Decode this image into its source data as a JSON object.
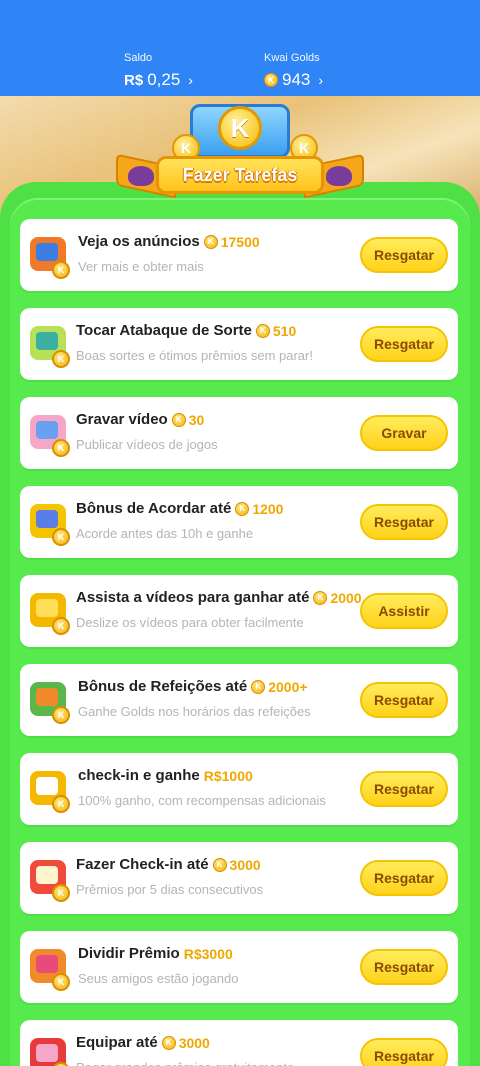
{
  "header": {
    "saldo_label": "Saldo",
    "saldo_currency": "R$",
    "saldo_value": "0,25",
    "golds_label": "Kwai Golds",
    "golds_value": "943",
    "chevron": "›"
  },
  "banner": {
    "title": "Fazer Tarefas",
    "k_letter": "K"
  },
  "tasks": [
    {
      "title": "Veja os anúncios",
      "reward": "17500",
      "reward_coin": true,
      "subtitle": "Ver mais e obter mais",
      "button": "Resgatar",
      "icon": "tv-icon"
    },
    {
      "title": "Tocar Atabaque de Sorte",
      "reward": "510",
      "reward_coin": true,
      "subtitle": "Boas sortes e ótimos prêmios sem parar!",
      "button": "Resgatar",
      "icon": "drum-icon"
    },
    {
      "title": "Gravar vídeo",
      "reward": "30",
      "reward_coin": true,
      "subtitle": "Publicar vídeos de jogos",
      "button": "Gravar",
      "icon": "camera-icon"
    },
    {
      "title": "Bônus de Acordar até",
      "reward": "1200",
      "reward_coin": true,
      "subtitle": "Acorde antes das 10h e ganhe",
      "button": "Resgatar",
      "icon": "moon-icon"
    },
    {
      "title": "Assista a vídeos para ganhar até",
      "reward": "2000",
      "reward_coin": true,
      "subtitle": "Deslize os vídeos para obter facilmente",
      "button": "Assistir",
      "icon": "video-camera-icon"
    },
    {
      "title": "Bônus de Refeições até",
      "reward": "2000+",
      "reward_coin": true,
      "subtitle": "Ganhe Golds nos horários das refeições",
      "button": "Resgatar",
      "icon": "lunchbox-icon"
    },
    {
      "title": "check-in e ganhe",
      "reward": "R$1000",
      "reward_coin": false,
      "subtitle": "100% ganho, com recompensas adicionais",
      "button": "Resgatar",
      "icon": "calendar-icon"
    },
    {
      "title": "Fazer Check-in até",
      "reward": "3000",
      "reward_coin": true,
      "subtitle": "Prêmios por 5 dias consecutivos",
      "button": "Resgatar",
      "icon": "checkin-calendar-icon"
    },
    {
      "title": "Dividir Prêmio",
      "reward": "R$3000",
      "reward_coin": false,
      "subtitle": "Seus amigos estão jogando",
      "button": "Resgatar",
      "icon": "gift-icon"
    },
    {
      "title": "Equipar até",
      "reward": "3000",
      "reward_coin": true,
      "subtitle": "Pegar grandes prêmios gratuitamente",
      "button": "Resgatar",
      "icon": "boxing-gloves-icon"
    }
  ],
  "colors": {
    "topbar": "#2f85f6",
    "panel": "#56ea4c",
    "button": "#ffd21a",
    "reward": "#f0a800"
  }
}
